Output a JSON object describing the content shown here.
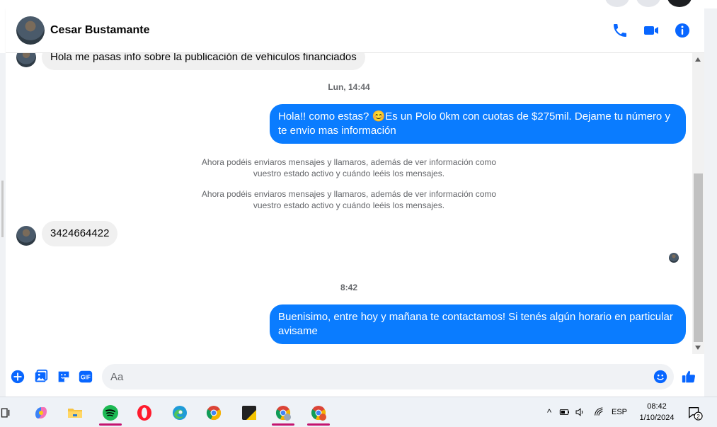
{
  "contact": {
    "name": "Cesar Bustamante"
  },
  "header_actions": [
    "phone-call",
    "video-call",
    "conversation-info"
  ],
  "messages": {
    "first_incoming": "Hola me pasas info sobre la publicación de vehiculos financiados",
    "time1": "Lun, 14:44",
    "outgoing1": "Hola!! como estas? 😊Es un Polo 0km con cuotas de $275mil. Dejame tu número y te envio mas información",
    "system1": "Ahora podéis enviaros mensajes y llamaros, además de ver información como vuestro estado activo y cuándo leéis los mensajes.",
    "system2": "Ahora podéis enviaros mensajes y llamaros, además de ver información como vuestro estado activo y cuándo leéis los mensajes.",
    "incoming_phone": "3424664422",
    "time2": "8:42",
    "outgoing2": "Buenisimo, entre hoy y mañana te contactamos! Si tenés algún horario en particular avisame"
  },
  "composer": {
    "placeholder": "Aa",
    "actions": [
      "add",
      "gallery",
      "sticker",
      "gif",
      "emoji",
      "like"
    ],
    "gif_label": "GIF"
  },
  "taskbar": {
    "apps": [
      "task-view",
      "copilot",
      "file-explorer",
      "spotify",
      "opera",
      "edge",
      "chrome",
      "sticky-notes",
      "chrome-profile-1",
      "chrome-profile-2"
    ],
    "language": "ESP",
    "time": "08:42",
    "date": "1/10/2024",
    "notification_count": "2"
  },
  "colors": {
    "accent": "#0a7cff",
    "bubble_in": "#f0f0f0",
    "icon_blue": "#0866ff"
  }
}
